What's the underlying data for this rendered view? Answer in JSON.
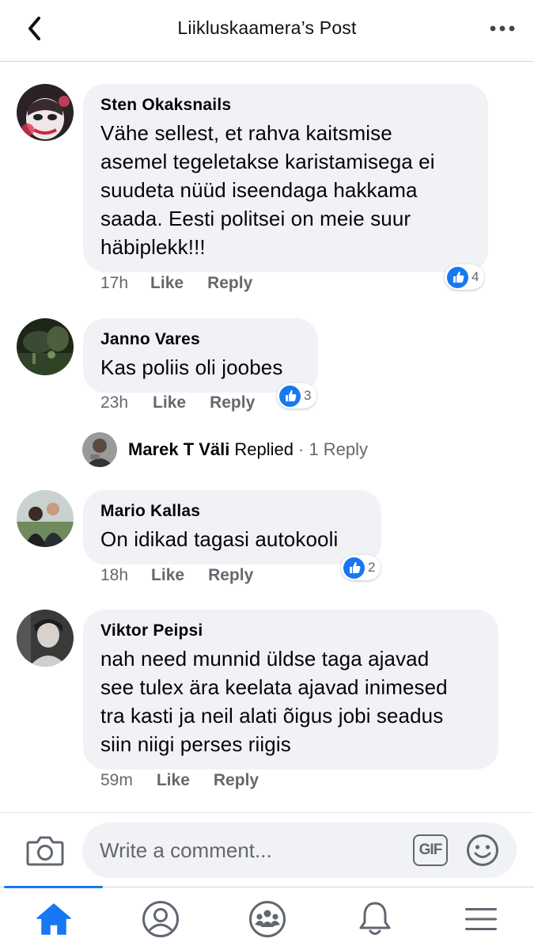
{
  "header": {
    "title": "Liikluskaamera’s Post",
    "back_icon": "chevron-left-icon",
    "more_icon": "more-dots-icon"
  },
  "comments": [
    {
      "author": "Sten Okaksnails",
      "text": "Vähe sellest, et rahva kaitsmise asemel tegeletakse karistamisega ei suudeta nüüd iseendaga hakkama saada. Eesti politsei on meie suur häbiplekk!!!",
      "lines": [
        "Vähe sellest, et rahva kaitsmise",
        "asemel tegeletakse karistamisega ei",
        "suudeta nüüd iseendaga hakkama",
        "saada. Eesti politsei on meie suur",
        "häbiplekk!!!"
      ],
      "time": "17h",
      "like": "Like",
      "reply": "Reply",
      "reactions": "4"
    },
    {
      "author": "Janno Vares",
      "text": "Kas poliis oli joobes",
      "time": "23h",
      "like": "Like",
      "reply": "Reply",
      "reactions": "3"
    },
    {
      "author": "Mario Kallas",
      "text": "On idikad tagasi autokooli",
      "time": "18h",
      "like": "Like",
      "reply": "Reply",
      "reactions": "2"
    },
    {
      "author": "Viktor Peipsi",
      "text": "nah need munnid üldse taga ajavad see tulex ära keelata ajavad inimesed tra kasti ja neil alati õigus jobi seadus siin niigi perses riigis",
      "lines": [
        "nah need munnid üldse taga ajavad",
        "see tulex ära keelata ajavad inimesed",
        "tra kasti ja neil alati õigus jobi seadus",
        "siin niigi perses riigis"
      ],
      "time": "59m",
      "like": "Like",
      "reply": "Reply"
    }
  ],
  "reply_thread": {
    "name": "Marek T Väli",
    "action": "Replied",
    "count": "· 1 Reply"
  },
  "composer": {
    "placeholder": "Write a comment...",
    "gif_label": "GIF",
    "camera_icon": "camera-icon",
    "emoji_icon": "emoji-icon"
  },
  "nav": {
    "items": [
      "home-icon",
      "profile-icon",
      "groups-icon",
      "notifications-icon",
      "menu-icon"
    ],
    "active": "home-icon"
  },
  "colors": {
    "accent": "#1877f2",
    "bubble": "#f0f2f5",
    "secondary_text": "#65676b"
  }
}
